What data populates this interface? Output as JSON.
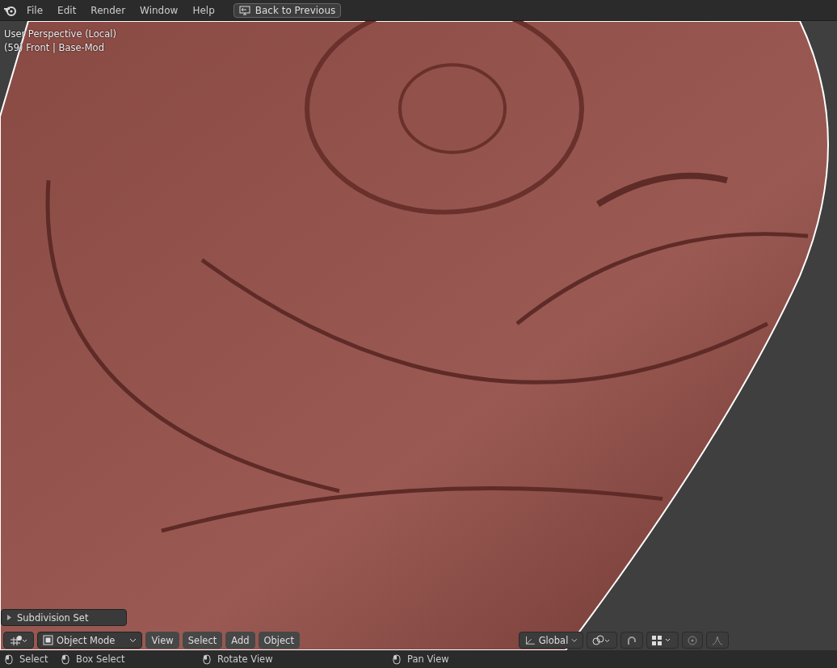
{
  "menu_bar": {
    "menus": [
      "File",
      "Edit",
      "Render",
      "Window",
      "Help"
    ],
    "back_button": "Back to Previous"
  },
  "viewport": {
    "overlay_lines": [
      "User Perspective (Local)",
      "(59) Front | Base-Mod"
    ],
    "last_operation": {
      "label": "Subdivision Set",
      "expanded": false
    },
    "header": {
      "mode": "Object Mode",
      "menus": [
        "View",
        "Select",
        "Add",
        "Object"
      ],
      "orientation": "Global"
    }
  },
  "status_bar": {
    "items": [
      "Select",
      "Box Select",
      "Rotate View",
      "Pan View"
    ]
  }
}
